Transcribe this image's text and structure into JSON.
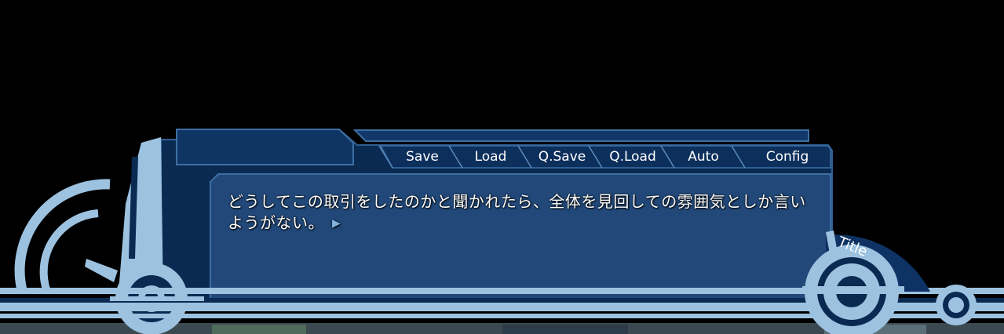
{
  "menu": {
    "items": [
      {
        "id": "save",
        "label": "Save"
      },
      {
        "id": "load",
        "label": "Load"
      },
      {
        "id": "qsave",
        "label": "Q.Save"
      },
      {
        "id": "qload",
        "label": "Q.Load"
      },
      {
        "id": "auto",
        "label": "Auto"
      },
      {
        "id": "config",
        "label": "Config"
      }
    ],
    "title_label": "Title"
  },
  "dialogue": {
    "text": "どうしてこの取引をしたのかと聞かれたら、全体を見回しての雰囲気としか言いようがない。",
    "continue_glyph": "▶"
  },
  "colors": {
    "background": "#000000",
    "frame_dark": "#0a2a52",
    "frame_mid": "#1c4a7a",
    "panel": "#214878",
    "accent_light": "#9cc2e0",
    "border": "#3d6fa3"
  }
}
